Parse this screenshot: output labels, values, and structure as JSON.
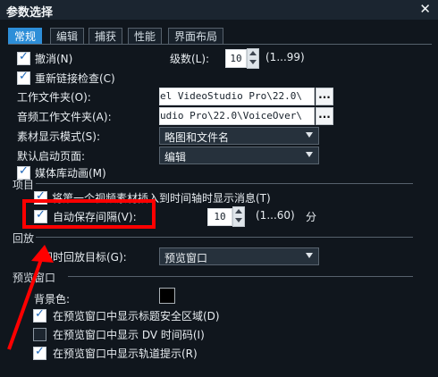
{
  "window": {
    "title": "参数选择"
  },
  "tabs": [
    {
      "label": "常规"
    },
    {
      "label": "编辑"
    },
    {
      "label": "捕获"
    },
    {
      "label": "性能"
    },
    {
      "label": "界面布局"
    }
  ],
  "general": {
    "undo_label": "撤消(N)",
    "levels_label": "级数(L):",
    "levels_value": "10",
    "levels_range": "(1...99)",
    "recheck_label": "重新链接检查(C)",
    "work_folder_label": "工作文件夹(O):",
    "work_folder_value": "el VideoStudio Pro\\22.0\\",
    "audio_folder_label": "音频工作文件夹(A):",
    "audio_folder_value": "udio Pro\\22.0\\VoiceOver\\",
    "dots": "...",
    "display_mode_label": "素材显示模式(S):",
    "display_mode_value": "略图和文件名",
    "default_page_label": "默认启动页面:",
    "default_page_value": "编辑",
    "library_anim_label": "媒体库动画(M)",
    "section_project": "项目",
    "insert_msg_label": "将第一个视频素材插入到时间轴时显示消息(T)",
    "autosave_label": "自动保存间隔(V):",
    "autosave_value": "10",
    "autosave_range": "(1...60)",
    "autosave_unit": "分",
    "section_playback": "回放",
    "instant_playback_label": "即时回放目标(G):",
    "instant_playback_value": "预览窗口",
    "section_preview": "预览窗口",
    "bg_color_label": "背景色:",
    "safe_area_label": "在预览窗口中显示标题安全区域(D)",
    "dv_timecode_label": "在预览窗口中显示 DV 时间码(I)",
    "track_hint_label": "在预览窗口中显示轨道提示(R)"
  },
  "colors": {
    "accent": "#2d8ed8",
    "highlight": "#ff0000",
    "background": "#10161d"
  }
}
